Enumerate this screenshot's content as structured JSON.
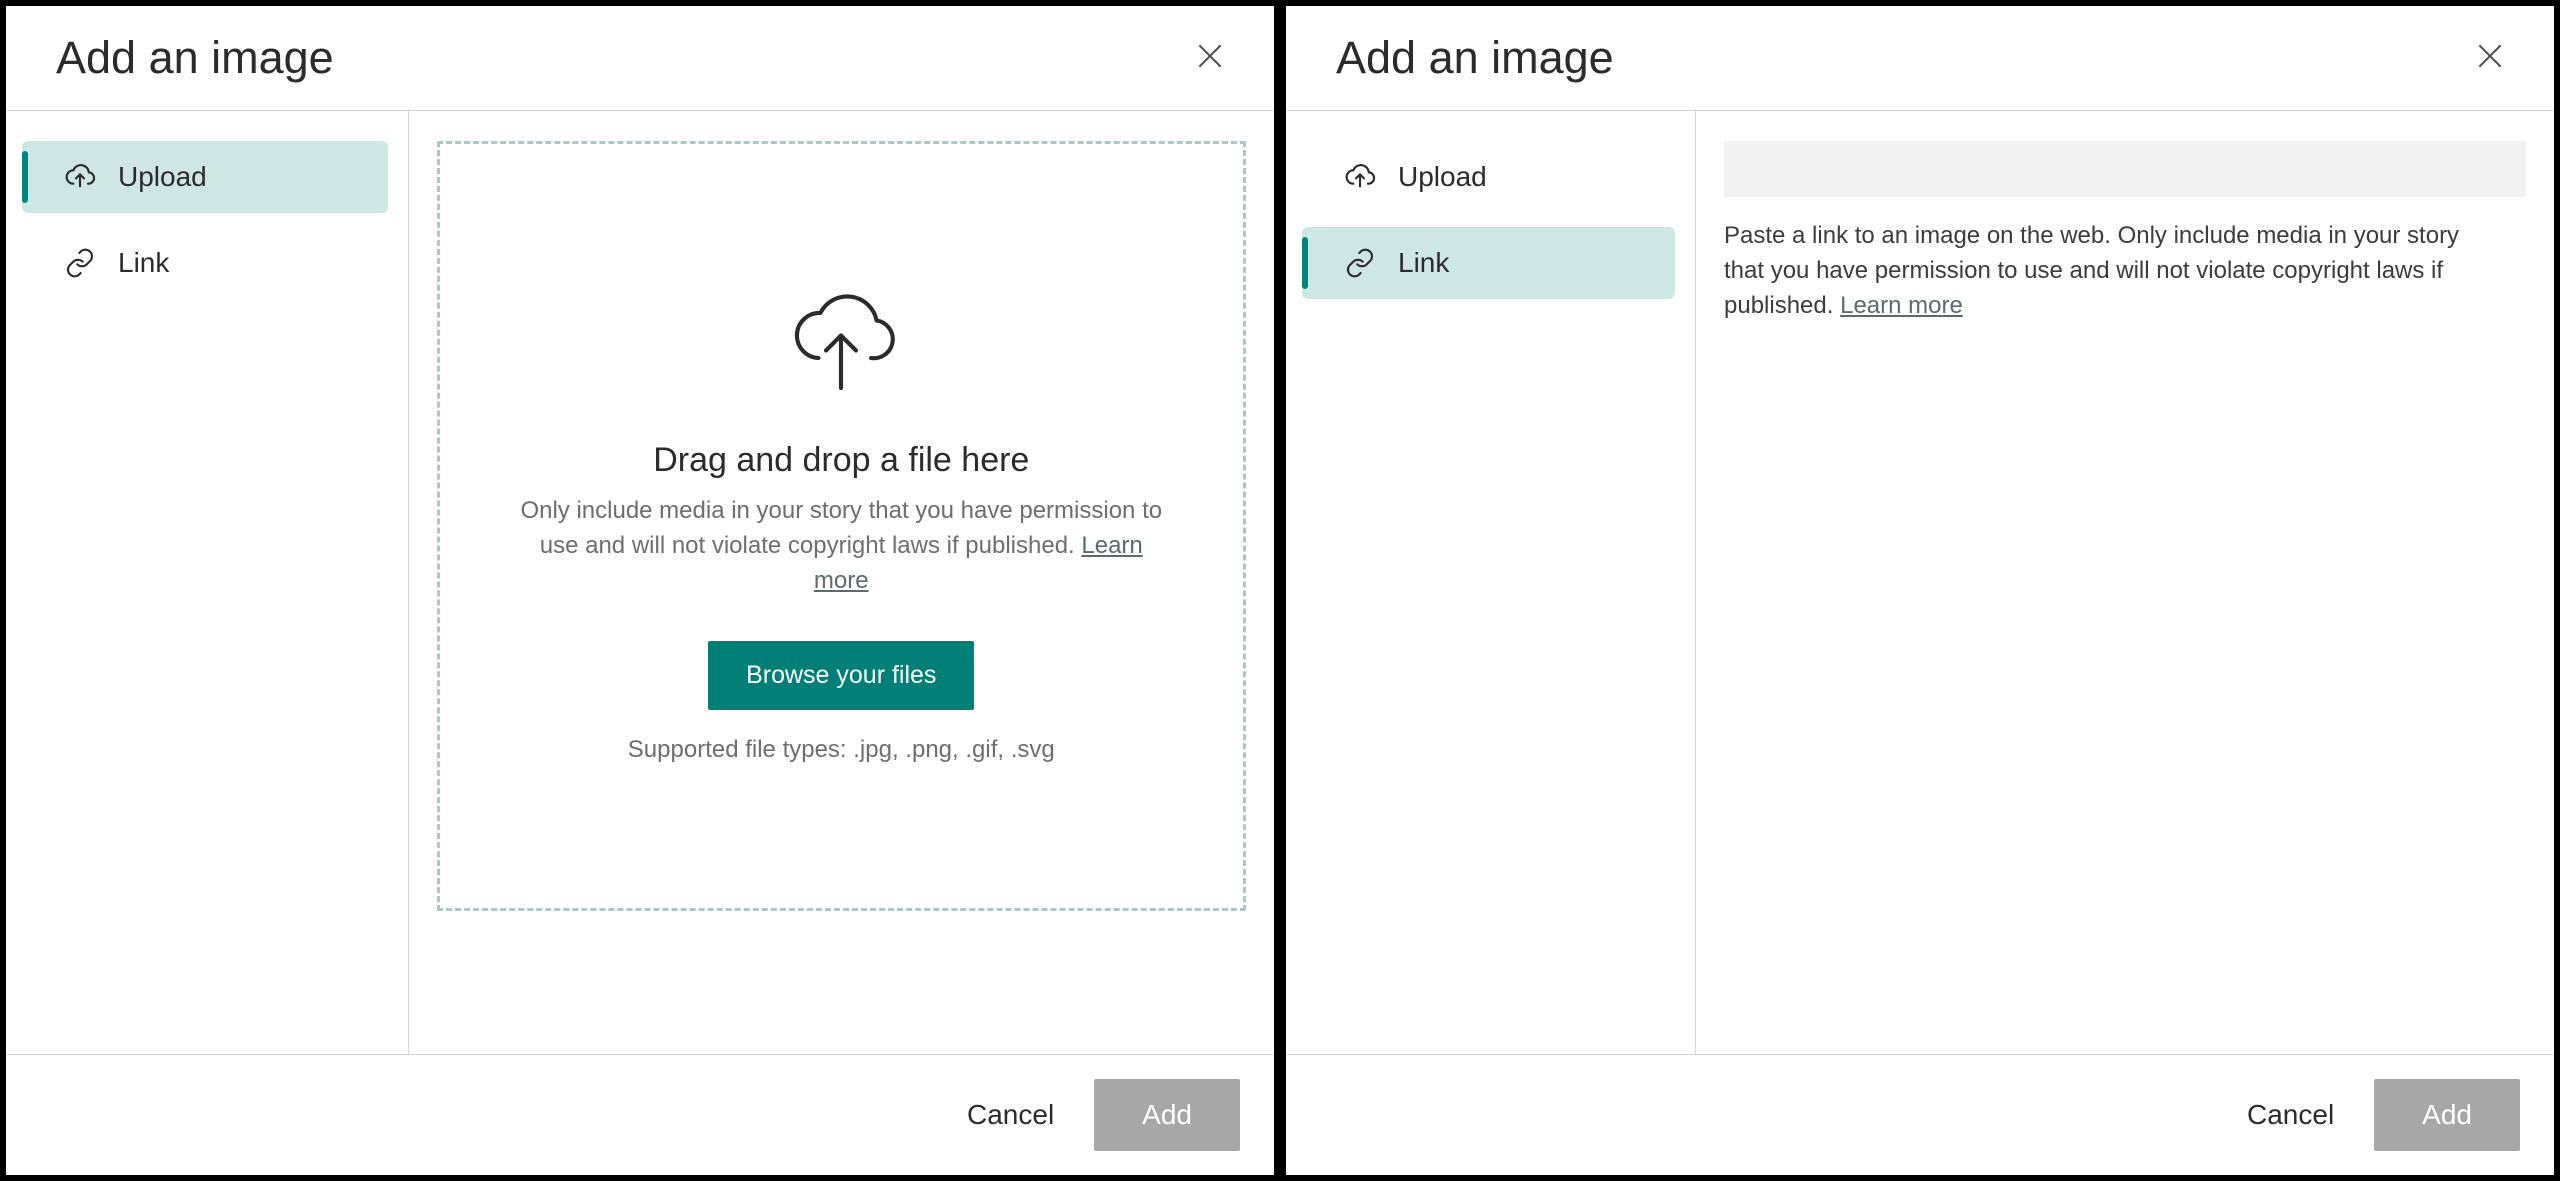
{
  "dialog": {
    "title": "Add an image",
    "tabs": {
      "upload": "Upload",
      "link": "Link"
    },
    "upload": {
      "headline": "Drag and drop a file here",
      "subtext": "Only include media in your story that you have permission to use and will not violate copyright laws if published. ",
      "learn_more": "Learn more",
      "browse_label": "Browse your files",
      "supported": "Supported file types: .jpg, .png, .gif, .svg"
    },
    "link": {
      "input_value": "",
      "help": "Paste a link to an image on the web. Only include media in your story that you have permission to use and will not violate copyright laws if published. ",
      "learn_more": "Learn more"
    },
    "footer": {
      "cancel": "Cancel",
      "add": "Add"
    }
  }
}
